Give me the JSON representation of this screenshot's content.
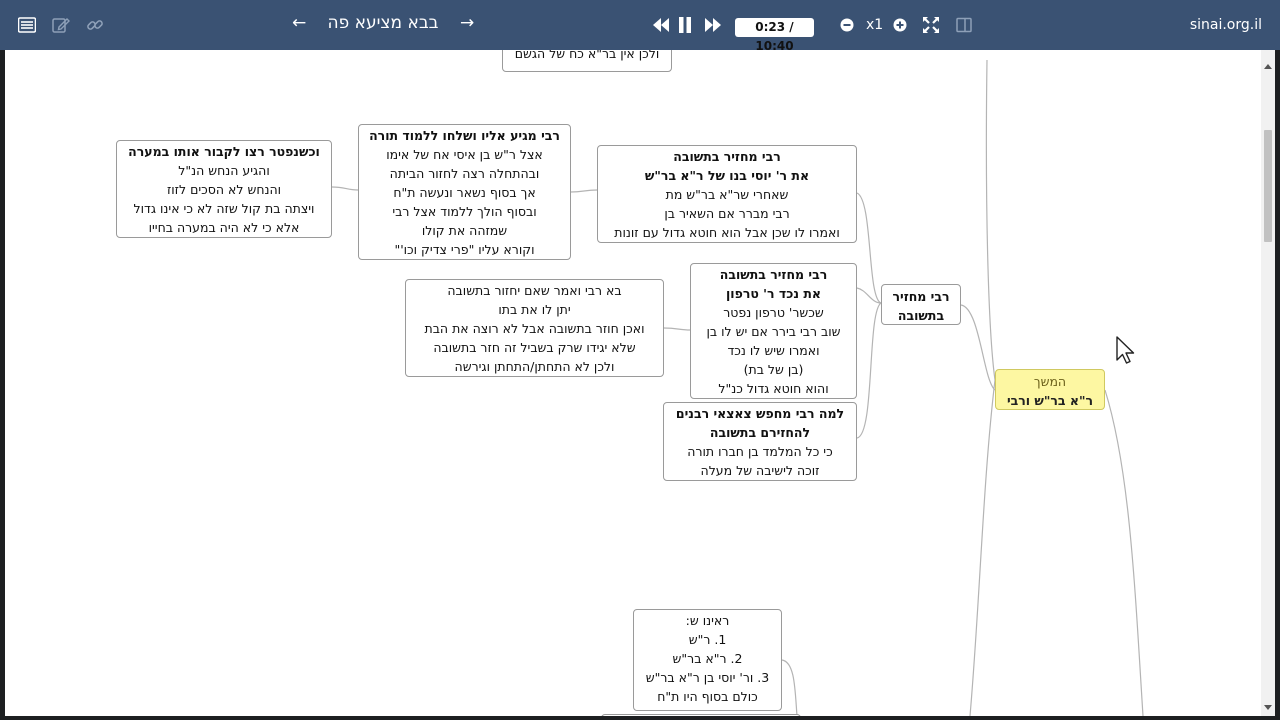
{
  "toolbar": {
    "title": "בבא מציעא פה",
    "prev_arrow": "←",
    "next_arrow": "→",
    "time": "0:23 / 10:40",
    "zoom": "x1",
    "site": "sinai.org.il",
    "icons": [
      "list-icon",
      "edit-icon",
      "link-icon",
      "rewind-icon",
      "pause-icon",
      "fast-forward-icon",
      "zoom-out-icon",
      "zoom-in-icon",
      "fullscreen-icon",
      "layout-icon"
    ]
  },
  "mindmap": {
    "top_partial": {
      "line1": "ולכן אין בר\"א כח של הגשם"
    },
    "cave": {
      "title": "וכשנפטר רצו לקבור אותו במערה",
      "lines": [
        "והגיע הנחש הנ\"ל",
        "והנחש לא הסכים לזוז",
        "ויצתה בת קול שזה לא כי אינו גדול",
        "אלא כי לא היה במערה בחייו"
      ]
    },
    "rabbi_arrives": {
      "title": "רבי מגיע אליו ושלחו ללמוד תורה",
      "lines": [
        "אצל ר\"ש בן איסי אח של אימו",
        "ובהתחלה רצה לחזור הביתה",
        "אך בסוף  נשאר ונעשה ת\"ח",
        "ובסוף הולך ללמוד אצל רבי",
        "שמזהה את קולו",
        "וקורא עליו \"פרי צדיק וכו'\""
      ]
    },
    "yossi": {
      "title1": "רבי מחזיר בתשובה",
      "title2": "את ר' יוסי בנו של ר\"א בר\"ש",
      "lines": [
        "שאחרי שר\"א בר\"ש מת",
        "רבי מברר אם השאיר בן",
        "ואמרו לו שכן אבל הוא חוטא גדול עם זונות"
      ]
    },
    "daughter": {
      "lines": [
        "בא רבי ואמר שאם יחזור בתשובה",
        "יתן לו את בתו",
        "ואכן חוזר בתשובה אבל לא רוצה את הבת",
        "שלא יגידו שרק בשביל זה חזר בתשובה",
        "ולכן לא התחתן/התחתן וגירשה"
      ]
    },
    "tarfon": {
      "title1": "רבי מחזיר בתשובה",
      "title2": "את נכד ר' טרפון",
      "lines": [
        "שכשר' טרפון נפטר",
        "שוב רבי בירר אם יש לו בן",
        "ואמרו שיש לו נכד",
        "(בן של בת)",
        "והוא חוטא גדול כנ\"ל"
      ]
    },
    "why": {
      "title1": "למה רבי מחפש צאצאי רבנים",
      "title2": "להחזירם בתשובה",
      "lines": [
        "כי כל המלמד בן חברו תורה",
        "זוכה לישיבה של מעלה"
      ]
    },
    "returns": {
      "line1": "רבי מחזיר",
      "line2": "בתשובה"
    },
    "continue": {
      "line1": "המשך",
      "line2": "ר\"א בר\"ש ורבי"
    },
    "we_saw": {
      "lines": [
        "ראינו ש:",
        "1. ר\"ש",
        "2. ר\"א בר\"ש",
        "3. ור' יוסי בן ר\"א בר\"ש",
        "כולם בסוף היו ת\"ח"
      ]
    }
  },
  "colors": {
    "toolbar": "#3a5273",
    "highlight": "#fdf7a2",
    "link": "#b4b4b4"
  }
}
